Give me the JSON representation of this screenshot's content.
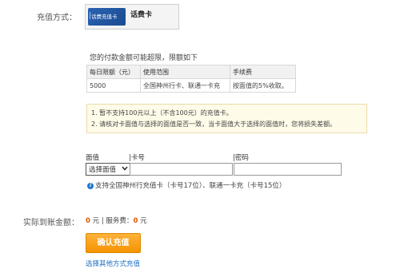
{
  "recharge_method": {
    "label": "充值方式：",
    "card_image_text": "话费充值卡",
    "method_name": "话费卡"
  },
  "limits": {
    "note": "您的付款金额可能超限，限额如下",
    "headers": [
      "每日限额（元）",
      "使用范围",
      "手续费"
    ],
    "rows": [
      [
        "5000",
        "全国神州行卡、联通一卡充",
        "按面值的5%收取。"
      ]
    ]
  },
  "tips": [
    "1.  暂不支持100元以上（不含100元）的充值卡。",
    "2.  请核对卡面值与选择的面值是否一致，当卡面值大于选择的面值时，您将损失差额。"
  ],
  "form": {
    "face_value_label": "面值",
    "card_number_label": "|卡号",
    "password_label": "|密码",
    "select_value": "选择面值",
    "info_text": "支持全国神州行充值卡（卡号17位）、联通一卡充（卡号15位）"
  },
  "amount": {
    "label": "实际到账金额：",
    "value": "0",
    "unit": "元",
    "separator": "|",
    "fee_label": "服务费：",
    "fee_value": "0",
    "fee_unit": "元"
  },
  "actions": {
    "confirm": "确认充值",
    "other_methods": "选择其他方式充值"
  },
  "colors": {
    "accent_orange": "#f49400",
    "link_blue": "#1a6ec2",
    "amount_orange": "#e05a00"
  }
}
